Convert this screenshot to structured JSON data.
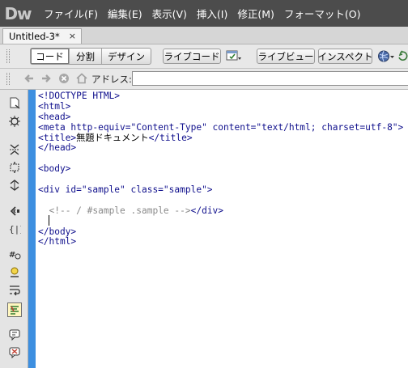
{
  "app": {
    "logo": "Dw"
  },
  "menu": [
    "ファイル(F)",
    "編集(E)",
    "表示(V)",
    "挿入(I)",
    "修正(M)",
    "フォーマット(O)"
  ],
  "tab": {
    "title": "Untitled-3*",
    "close": "×"
  },
  "toolbar": {
    "code": "コード",
    "split": "分割",
    "design": "デザイン",
    "live_code": "ライブコード",
    "live_view": "ライブビュー",
    "inspect": "インスペクト"
  },
  "addressbar": {
    "label": "アドレス:",
    "value": ""
  },
  "code_lines": [
    [
      {
        "t": "tag",
        "v": "<!DOCTYPE HTML>"
      }
    ],
    [
      {
        "t": "tag",
        "v": "<html>"
      }
    ],
    [
      {
        "t": "tag",
        "v": "<head>"
      }
    ],
    [
      {
        "t": "tag",
        "v": "<meta http-equiv=\"Content-Type\" content=\"text/html; charset=utf-8\">"
      }
    ],
    [
      {
        "t": "tag",
        "v": "<title>"
      },
      {
        "t": "text",
        "v": "無題ドキュメント"
      },
      {
        "t": "tag",
        "v": "</title>"
      }
    ],
    [
      {
        "t": "tag",
        "v": "</head>"
      }
    ],
    [
      {
        "t": "text",
        "v": ""
      }
    ],
    [
      {
        "t": "tag",
        "v": "<body>"
      }
    ],
    [
      {
        "t": "text",
        "v": ""
      }
    ],
    [
      {
        "t": "tag",
        "v": "<div id=\"sample\" class=\"sample\">"
      }
    ],
    [
      {
        "t": "text",
        "v": ""
      }
    ],
    [
      {
        "t": "text",
        "v": "  "
      },
      {
        "t": "cmt",
        "v": "<!-- / #sample .sample -->"
      },
      {
        "t": "tag",
        "v": "</div>"
      }
    ],
    [
      {
        "t": "text",
        "v": ""
      }
    ],
    [
      {
        "t": "tag",
        "v": "</body>"
      }
    ],
    [
      {
        "t": "tag",
        "v": "</html>"
      }
    ]
  ]
}
